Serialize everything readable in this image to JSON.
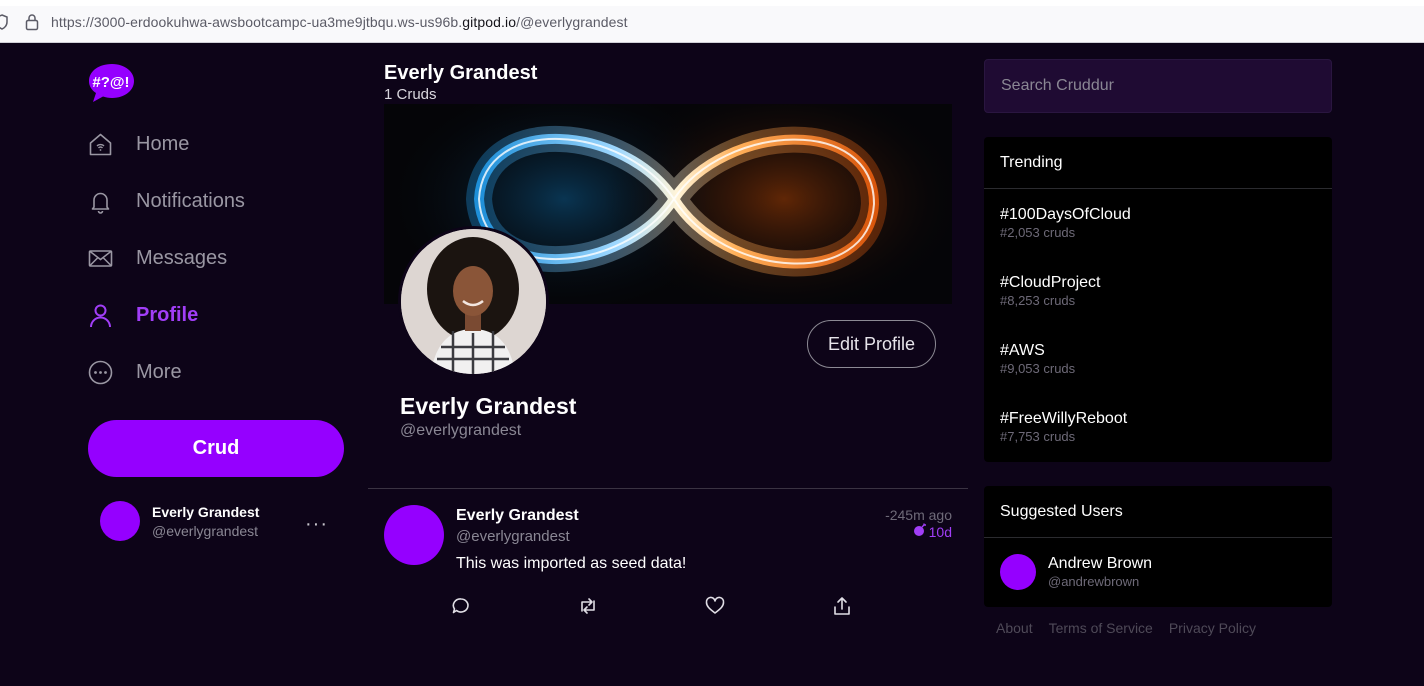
{
  "browser": {
    "url_prefix": "https://3000-erdookuhwa-awsbootcampc-ua3me9jtbqu.ws-us96b.",
    "url_domain": "gitpod.io",
    "url_path": "/@everlygrandest"
  },
  "logo": {
    "text": "#?@!",
    "color": "#9500ff"
  },
  "nav": [
    {
      "label": "Home",
      "icon": "home-icon"
    },
    {
      "label": "Notifications",
      "icon": "bell-icon"
    },
    {
      "label": "Messages",
      "icon": "envelope-icon"
    },
    {
      "label": "Profile",
      "icon": "user-icon",
      "active": true
    },
    {
      "label": "More",
      "icon": "more-circle-icon"
    }
  ],
  "crud_button": "Crud",
  "current_user": {
    "name": "Everly Grandest",
    "handle": "@everlygrandest"
  },
  "profile": {
    "title": "Everly Grandest",
    "crud_count": "1 Cruds",
    "display_name": "Everly Grandest",
    "handle": "@everlygrandest",
    "edit_button": "Edit Profile"
  },
  "post": {
    "name": "Everly Grandest",
    "handle": "@everlygrandest",
    "time": "-245m ago",
    "expires": "10d",
    "message": "This was imported as seed data!"
  },
  "search": {
    "placeholder": "Search Cruddur"
  },
  "trending": {
    "title": "Trending",
    "items": [
      {
        "tag": "#100DaysOfCloud",
        "count": "#2,053 cruds"
      },
      {
        "tag": "#CloudProject",
        "count": "#8,253 cruds"
      },
      {
        "tag": "#AWS",
        "count": "#9,053 cruds"
      },
      {
        "tag": "#FreeWillyReboot",
        "count": "#7,753 cruds"
      }
    ]
  },
  "suggested": {
    "title": "Suggested Users",
    "users": [
      {
        "name": "Andrew Brown",
        "handle": "@andrewbrown"
      }
    ]
  },
  "footer": {
    "about": "About",
    "terms": "Terms of Service",
    "privacy": "Privacy Policy"
  },
  "colors": {
    "accent": "#9500ff",
    "active_nav": "#a13ef7",
    "background": "#0d0418"
  }
}
